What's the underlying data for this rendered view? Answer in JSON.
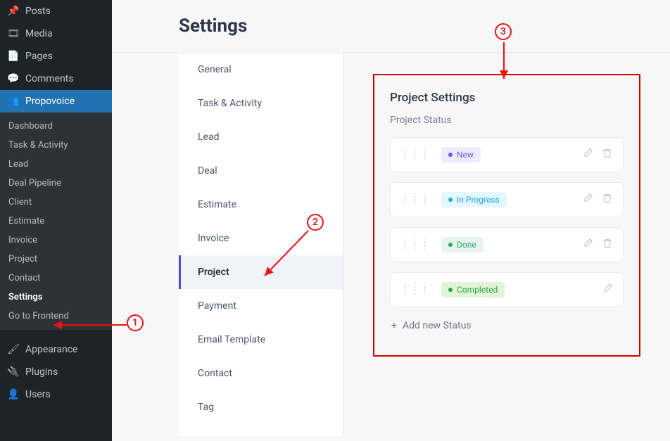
{
  "page": {
    "title": "Settings"
  },
  "wp_menu": {
    "top": [
      {
        "label": "Posts",
        "icon": "pin-icon"
      },
      {
        "label": "Media",
        "icon": "media-icon"
      },
      {
        "label": "Pages",
        "icon": "pages-icon"
      },
      {
        "label": "Comments",
        "icon": "comment-icon"
      },
      {
        "label": "Propovoice",
        "icon": "group-icon",
        "active": true
      }
    ],
    "submenu": [
      "Dashboard",
      "Task & Activity",
      "Lead",
      "Deal Pipeline",
      "Client",
      "Estimate",
      "Invoice",
      "Project",
      "Contact",
      "Settings",
      "Go to Frontend"
    ],
    "submenu_current": "Settings",
    "bottom": [
      {
        "label": "Appearance",
        "icon": "brush-icon"
      },
      {
        "label": "Plugins",
        "icon": "plug-icon"
      },
      {
        "label": "Users",
        "icon": "user-icon"
      }
    ]
  },
  "settings_nav": [
    "General",
    "Task & Activity",
    "Lead",
    "Deal",
    "Estimate",
    "Invoice",
    "Project",
    "Payment",
    "Email Template",
    "Contact",
    "Tag"
  ],
  "settings_nav_active": "Project",
  "panel": {
    "title": "Project Settings",
    "subtitle": "Project Status",
    "statuses": [
      {
        "label": "New",
        "bg": "#eeeaff",
        "dot": "#6c5ce7",
        "color": "#6c5ce7",
        "deletable": true
      },
      {
        "label": "In Progress",
        "bg": "#e4f6ff",
        "dot": "#1aa7dd",
        "color": "#1aa7dd",
        "deletable": true
      },
      {
        "label": "Done",
        "bg": "#e6f4ed",
        "dot": "#2fa36b",
        "color": "#2fa36b",
        "deletable": true
      },
      {
        "label": "Completed",
        "bg": "#dff4d9",
        "dot": "#2fa33b",
        "color": "#2fa33b",
        "deletable": false
      }
    ],
    "add_label": "Add new Status"
  },
  "annotations": {
    "a1": "1",
    "a2": "2",
    "a3": "3"
  }
}
